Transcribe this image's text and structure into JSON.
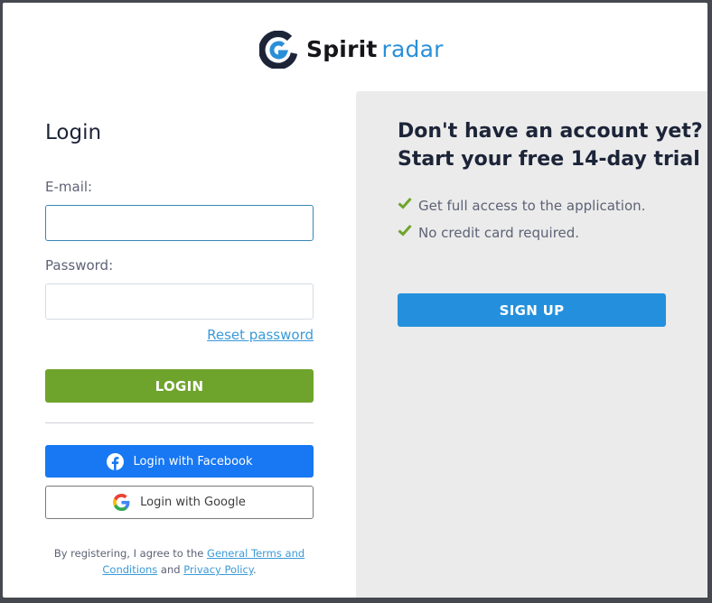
{
  "brand": {
    "name_bold": "Spirit",
    "name_light": "radar",
    "icon": "spiritradar-logo-icon",
    "colors": {
      "dark": "#1c2438",
      "accent": "#2a8fd8"
    }
  },
  "login": {
    "title": "Login",
    "email_label": "E-mail:",
    "email_value": "",
    "email_placeholder": "",
    "password_label": "Password:",
    "password_value": "",
    "password_placeholder": "",
    "reset_link": "Reset password",
    "login_button": "LOGIN",
    "facebook_button": "Login with Facebook",
    "google_button": "Login with Google",
    "terms": {
      "prefix": "By registering, I agree to the ",
      "terms_link": "General Terms and Conditions",
      "middle": " and ",
      "privacy_link": "Privacy Policy",
      "suffix": "."
    },
    "colors": {
      "login_button": "#6fa42c",
      "facebook": "#1877f2",
      "link": "#3a9ad9"
    }
  },
  "signup": {
    "title_line1": "Don't have an account yet?",
    "title_line2": "Start your free 14-day trial",
    "benefits": [
      {
        "icon": "check-icon",
        "text": "Get full access to the application."
      },
      {
        "icon": "check-icon",
        "text": "No credit card required."
      }
    ],
    "signup_button": "SIGN UP",
    "colors": {
      "button": "#2490dd",
      "check": "#6fa42c",
      "panel": "#ebebeb"
    }
  }
}
